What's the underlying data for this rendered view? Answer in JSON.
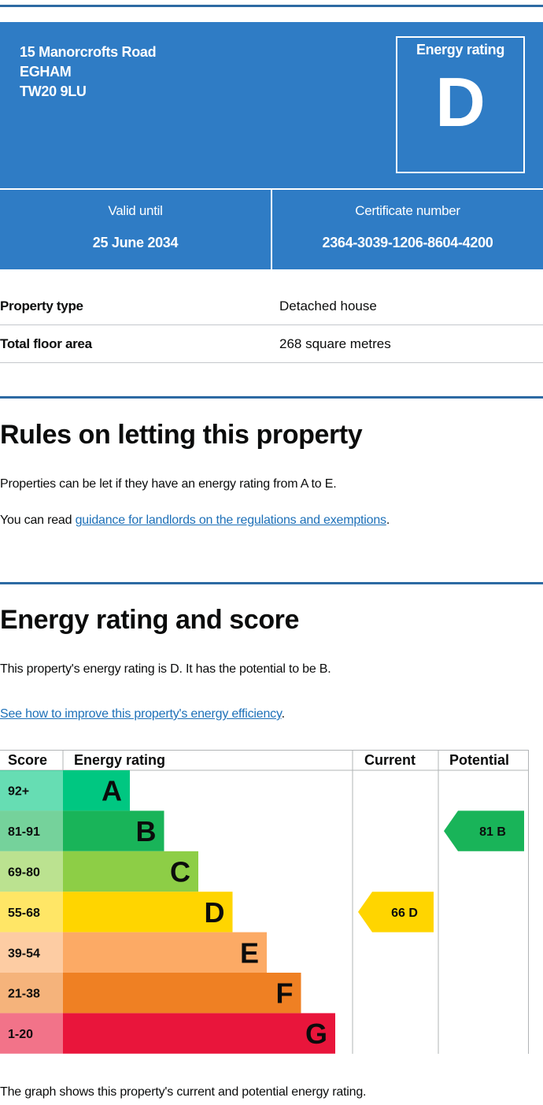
{
  "header": {
    "address_lines": [
      "15 Manorcrofts Road",
      "EGHAM",
      "TW20 9LU"
    ],
    "rating_label": "Energy rating",
    "rating_letter": "D",
    "valid_until_label": "Valid until",
    "valid_until_value": "25 June 2034",
    "certificate_label": "Certificate number",
    "certificate_value": "2364-3039-1206-8604-4200"
  },
  "property": [
    {
      "key": "Property type",
      "value": "Detached house"
    },
    {
      "key": "Total floor area",
      "value": "268 square metres"
    }
  ],
  "rules": {
    "heading": "Rules on letting this property",
    "text": "Properties can be let if they have an energy rating from A to E.",
    "guidance_prefix": "You can read ",
    "guidance_link": "guidance for landlords on the regulations and exemptions",
    "guidance_suffix": "."
  },
  "energy": {
    "heading": "Energy rating and score",
    "text": "This property's energy rating is D. It has the potential to be B.",
    "improve_link": "See how to improve this property's energy efficiency",
    "improve_suffix": ".",
    "footer": "The graph shows this property's current and potential energy rating."
  },
  "chart_data": {
    "type": "table",
    "headers": [
      "Score",
      "Energy rating",
      "Current",
      "Potential"
    ],
    "bands": [
      {
        "score": "92+",
        "letter": "A",
        "color": "#00c781"
      },
      {
        "score": "81-91",
        "letter": "B",
        "color": "#19b459"
      },
      {
        "score": "69-80",
        "letter": "C",
        "color": "#8dce46"
      },
      {
        "score": "55-68",
        "letter": "D",
        "color": "#ffd500"
      },
      {
        "score": "39-54",
        "letter": "E",
        "color": "#fcaa65"
      },
      {
        "score": "21-38",
        "letter": "F",
        "color": "#ef8023"
      },
      {
        "score": "1-20",
        "letter": "G",
        "color": "#e9153b"
      }
    ],
    "current": {
      "score": 66,
      "letter": "D",
      "label": "66 D",
      "color": "#ffd500"
    },
    "potential": {
      "score": 81,
      "letter": "B",
      "label": "81 B",
      "color": "#19b459"
    }
  }
}
